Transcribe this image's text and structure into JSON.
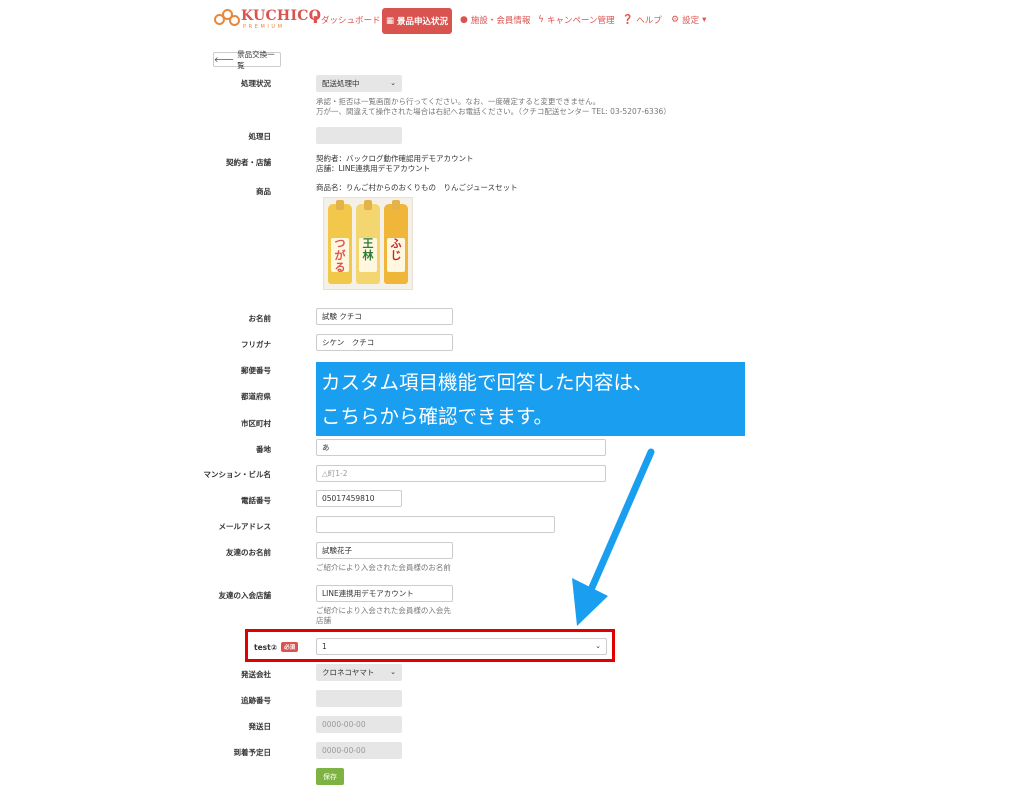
{
  "brand": {
    "name": "KUCHICO",
    "sub": "PREMIUM"
  },
  "nav": {
    "dashboard": "ダッシュボード",
    "exchange_status": "景品申込状況",
    "facility_member": "施設・会員情報",
    "campaign": "キャンペーン管理",
    "help": "ヘルプ",
    "settings": "設定"
  },
  "back_button": "景品交換一覧",
  "form": {
    "status_label": "処理状況",
    "status_value": "配送処理中",
    "status_note_1": "承認・拒否は一覧画面から行ってください。なお、一度確定すると変更できません。",
    "status_note_2": "万が一、間違えて操作された場合は右記へお電話ください。（クチコ配送センター TEL: 03-5207-6336）",
    "process_date_label": "処理日",
    "contract_label": "契約者・店舗",
    "contract_value": "契約者：バックログ動作確認用デモアカウント",
    "store_value": "店舗：LINE連携用デモアカウント",
    "product_label": "商品",
    "product_value": "商品名：りんご村からのおくりもの　りんごジュースセット",
    "product_labels": [
      "つがる",
      "王林",
      "ふじ"
    ],
    "name_label": "お名前",
    "name_value": "試験 クチコ",
    "kana_label": "フリガナ",
    "kana_value": "シケン　クチコ",
    "zip_label": "郵便番号",
    "pref_label": "都道府県",
    "city_label": "市区町村",
    "street_label": "番地",
    "street_value": "あ",
    "building_label": "マンション・ビル名",
    "building_placeholder": "△町1-2",
    "phone_label": "電話番号",
    "phone_value": "05017459810",
    "email_label": "メールアドレス",
    "email_value": "",
    "friend_name_label": "友達のお名前",
    "friend_name_value": "試験花子",
    "friend_name_help": "ご紹介により入会された会員様のお名前",
    "friend_store_label": "友達の入会店舗",
    "friend_store_value": "LINE連携用デモアカウント",
    "friend_store_help_1": "ご紹介により入会された会員様の入会先",
    "friend_store_help_2": "店舗",
    "custom_label": "test②",
    "required_badge": "必須",
    "custom_value": "1",
    "carrier_label": "発送会社",
    "carrier_value": "クロネコヤマト",
    "tracking_label": "追跡番号",
    "ship_date_label": "発送日",
    "ship_date_value": "0000-00-00",
    "arrival_label": "到着予定日",
    "arrival_value": "0000-00-00",
    "save_button": "保存"
  },
  "callout": {
    "line1": "カスタム項目機能で回答した内容は、",
    "line2": "こちらから確認できます。"
  },
  "colors": {
    "accent": "#d9534f",
    "callout": "#1a9ef0",
    "highlight": "#e00000",
    "save": "#7cb342"
  }
}
